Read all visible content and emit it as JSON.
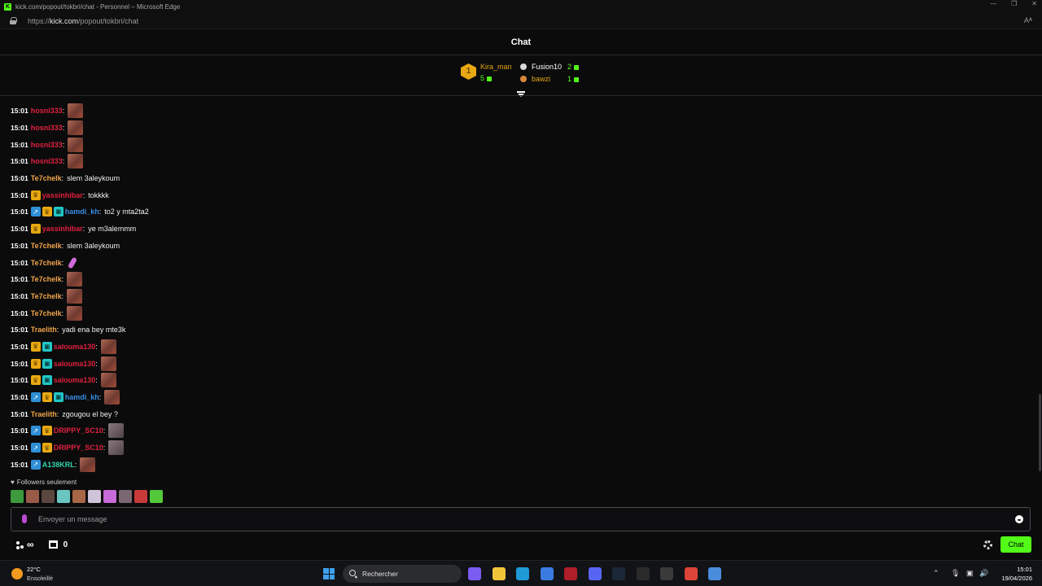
{
  "browser": {
    "window_title": "kick.com/popout/tokbri/chat - Personnel – Microsoft Edge",
    "url_prefix": "https://",
    "url_domain": "kick.com",
    "url_path": "/popout/tokbri/chat",
    "read_aloud": "Aᴬ"
  },
  "chat": {
    "header": "Chat",
    "leaderboard": {
      "rank1": {
        "rank": "1",
        "name": "Kira_man",
        "count": "5"
      },
      "rank2": {
        "name": "Fusion10",
        "count": "2"
      },
      "rank3": {
        "name": "bawzi",
        "count": "1"
      }
    },
    "messages": [
      {
        "time": "15:01",
        "badges": [],
        "user": "hosni333",
        "color": "#e0213d",
        "text": "",
        "emote": "face"
      },
      {
        "time": "15:01",
        "badges": [],
        "user": "hosni333",
        "color": "#e0213d",
        "text": "",
        "emote": "face"
      },
      {
        "time": "15:01",
        "badges": [],
        "user": "hosni333",
        "color": "#e0213d",
        "text": "",
        "emote": "face"
      },
      {
        "time": "15:01",
        "badges": [],
        "user": "hosni333",
        "color": "#e0213d",
        "text": "",
        "emote": "face"
      },
      {
        "time": "15:01",
        "badges": [],
        "user": "Te7chelk",
        "color": "#f1a54a",
        "text": "slem 3aleykoum",
        "emote": ""
      },
      {
        "time": "15:01",
        "badges": [
          "crown"
        ],
        "user": "yassinhibar",
        "color": "#e0213d",
        "text": "tokkkk",
        "emote": ""
      },
      {
        "time": "15:01",
        "badges": [
          "gift",
          "crown",
          "sub"
        ],
        "user": "hamdi_kh",
        "color": "#3a8ee6",
        "text": "to2 y mta2ta2",
        "emote": ""
      },
      {
        "time": "15:01",
        "badges": [
          "crown"
        ],
        "user": "yassinhibar",
        "color": "#e0213d",
        "text": "ye m3alemmm",
        "emote": ""
      },
      {
        "time": "15:01",
        "badges": [],
        "user": "Te7chelk",
        "color": "#f1a54a",
        "text": "slem 3aleykoum",
        "emote": ""
      },
      {
        "time": "15:01",
        "badges": [],
        "user": "Te7chelk",
        "color": "#f1a54a",
        "text": "",
        "emote": "pink"
      },
      {
        "time": "15:01",
        "badges": [],
        "user": "Te7chelk",
        "color": "#f1a54a",
        "text": "",
        "emote": "face"
      },
      {
        "time": "15:01",
        "badges": [],
        "user": "Te7chelk",
        "color": "#f1a54a",
        "text": "",
        "emote": "face"
      },
      {
        "time": "15:01",
        "badges": [],
        "user": "Te7chelk",
        "color": "#f1a54a",
        "text": "",
        "emote": "face"
      },
      {
        "time": "15:01",
        "badges": [],
        "user": "Traelith",
        "color": "#f1a54a",
        "text": "yadi ena bey mte3k",
        "emote": ""
      },
      {
        "time": "15:01",
        "badges": [
          "crown",
          "sub"
        ],
        "user": "salouma130",
        "color": "#e0213d",
        "text": "",
        "emote": "face"
      },
      {
        "time": "15:01",
        "badges": [
          "crown",
          "sub"
        ],
        "user": "salouma130",
        "color": "#e0213d",
        "text": "",
        "emote": "face"
      },
      {
        "time": "15:01",
        "badges": [
          "crown",
          "sub"
        ],
        "user": "salouma130",
        "color": "#e0213d",
        "text": "",
        "emote": "face"
      },
      {
        "time": "15:01",
        "badges": [
          "gift",
          "crown",
          "sub"
        ],
        "user": "hamdi_kh",
        "color": "#3a8ee6",
        "text": "",
        "emote": "face"
      },
      {
        "time": "15:01",
        "badges": [],
        "user": "Traelith",
        "color": "#f1a54a",
        "text": "zgougou el bey ?",
        "emote": ""
      },
      {
        "time": "15:01",
        "badges": [
          "gift",
          "crown"
        ],
        "user": "DRIPPY_SC10",
        "color": "#e0213d",
        "text": "",
        "emote": "gray"
      },
      {
        "time": "15:01",
        "badges": [
          "gift",
          "crown"
        ],
        "user": "DRIPPY_SC10",
        "color": "#e0213d",
        "text": "",
        "emote": "gray"
      },
      {
        "time": "15:01",
        "badges": [
          "gift"
        ],
        "user": "A138KRL",
        "color": "#2fd4a8",
        "text": "",
        "emote": "face"
      }
    ],
    "followers_only": "Followers seulement",
    "quick_emotes": [
      "#3c9a3c",
      "#9a5a48",
      "#5b4640",
      "#6ac5c0",
      "#a86848",
      "#d0c4d8",
      "#c86ad8",
      "#7a6870",
      "#c83a3a",
      "#53c83a"
    ],
    "input_placeholder": "Envoyer un message",
    "infinity": "∞",
    "store_count": "0",
    "send_label": "Chat"
  },
  "taskbar": {
    "temperature": "22°C",
    "condition": "Ensoleillé",
    "search_label": "Rechercher",
    "time": "15:01",
    "date": "19/04/2026",
    "apps": [
      {
        "name": "copilot-icon",
        "color": "#7a5cf0"
      },
      {
        "name": "folder-icon",
        "color": "#f0c53a"
      },
      {
        "name": "edge-icon",
        "color": "#1f9ad6"
      },
      {
        "name": "store-icon",
        "color": "#3a7be0"
      },
      {
        "name": "acrobat-icon",
        "color": "#b01e2a"
      },
      {
        "name": "discord-icon",
        "color": "#5865f2"
      },
      {
        "name": "steam-icon",
        "color": "#1b2838"
      },
      {
        "name": "epic-icon",
        "color": "#2a2a2a"
      },
      {
        "name": "obs-icon",
        "color": "#3a3a3a"
      },
      {
        "name": "chrome-icon",
        "color": "#db4437"
      },
      {
        "name": "chrome-profile-icon",
        "color": "#4a8cdc"
      }
    ]
  }
}
